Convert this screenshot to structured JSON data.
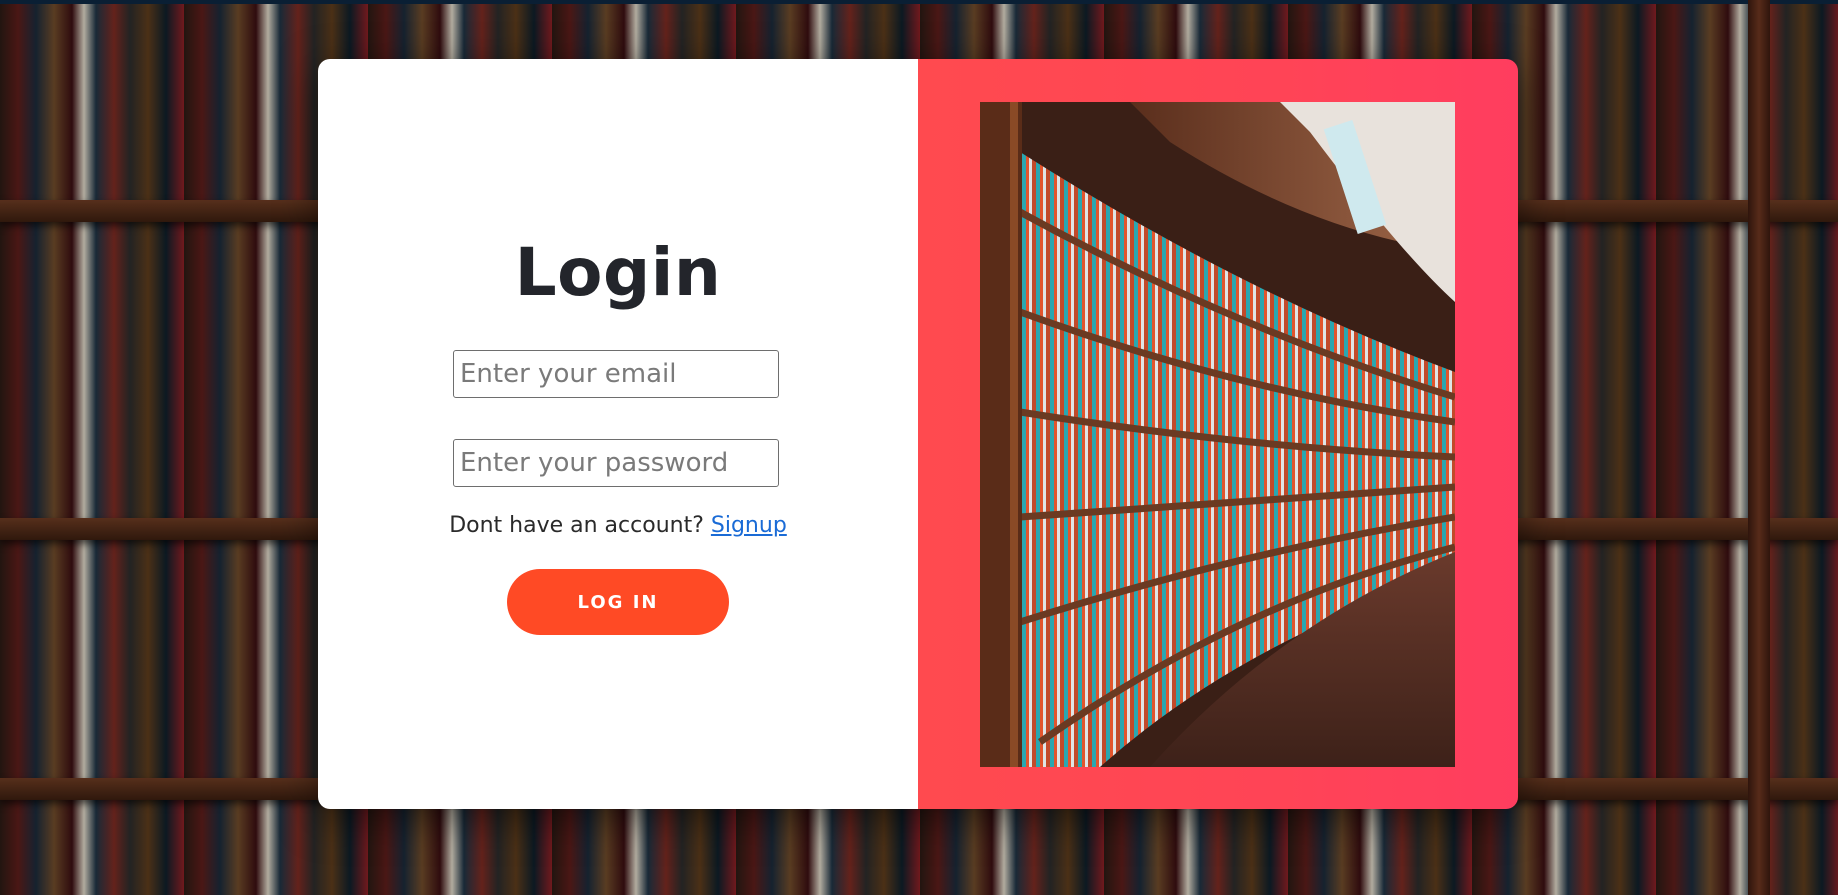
{
  "page": {
    "title": "Login"
  },
  "form": {
    "email_placeholder": "Enter your email",
    "password_placeholder": "Enter your password",
    "signup_prompt": "Dont have an account?",
    "signup_link": "Signup",
    "login_button": "LOG IN"
  },
  "colors": {
    "button": "#ff4a25",
    "panel_accent": "#ff4456",
    "link": "#1a6bd6",
    "title": "#23252b"
  },
  "images": {
    "background": "bookshelf-background",
    "panel_photo": "curved-library-bookshelves-photo"
  }
}
